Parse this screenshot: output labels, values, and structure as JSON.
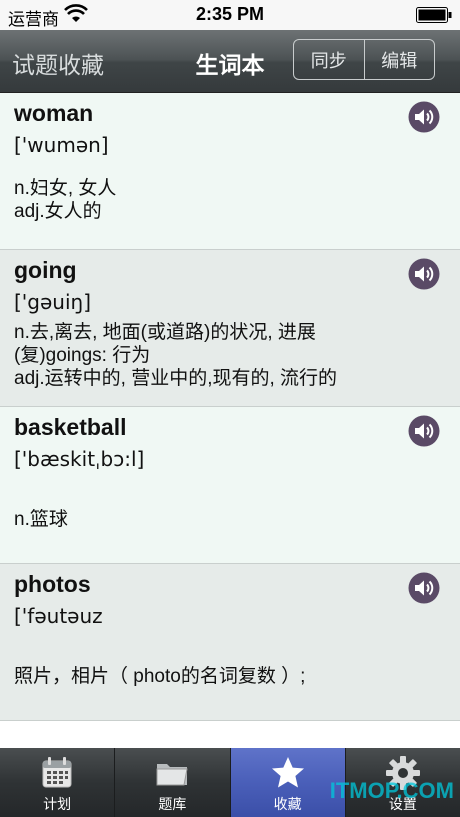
{
  "status_bar": {
    "carrier": "运营商",
    "time": "2:35 PM"
  },
  "nav": {
    "left_label": "试题收藏",
    "title": "生词本",
    "sync_label": "同步",
    "edit_label": "编辑"
  },
  "words": [
    {
      "word": "woman",
      "phonetic": "['wumən]",
      "definitions": [
        "n.妇女, 女人",
        "adj.女人的"
      ]
    },
    {
      "word": "going",
      "phonetic": "['gəuiŋ]",
      "definitions": [
        "n.去,离去, 地面(或道路)的状况, 进展",
        "(复)goings: 行为",
        "adj.运转中的, 营业中的,现有的, 流行的"
      ]
    },
    {
      "word": "basketball",
      "phonetic": "['bæskitˌbɔ:l]",
      "definitions": [
        "n.篮球"
      ]
    },
    {
      "word": "photos",
      "phonetic": "['fəutəuz",
      "definitions": [
        "照片，相片（ photo的名词复数 ）;"
      ]
    }
  ],
  "tabs": [
    {
      "label": "计划",
      "icon": "calendar-icon"
    },
    {
      "label": "题库",
      "icon": "folder-icon"
    },
    {
      "label": "收藏",
      "icon": "star-icon"
    },
    {
      "label": "设置",
      "icon": "gear-icon"
    }
  ],
  "active_tab": "收藏",
  "watermark": "ITMOP.COM",
  "colors": {
    "nav_bar": "#4c5254",
    "active_tab": "#4a5fb9",
    "card_light": "#f0f8f4",
    "card_dark": "#e6ebe9",
    "speaker": "#5a4a66"
  }
}
